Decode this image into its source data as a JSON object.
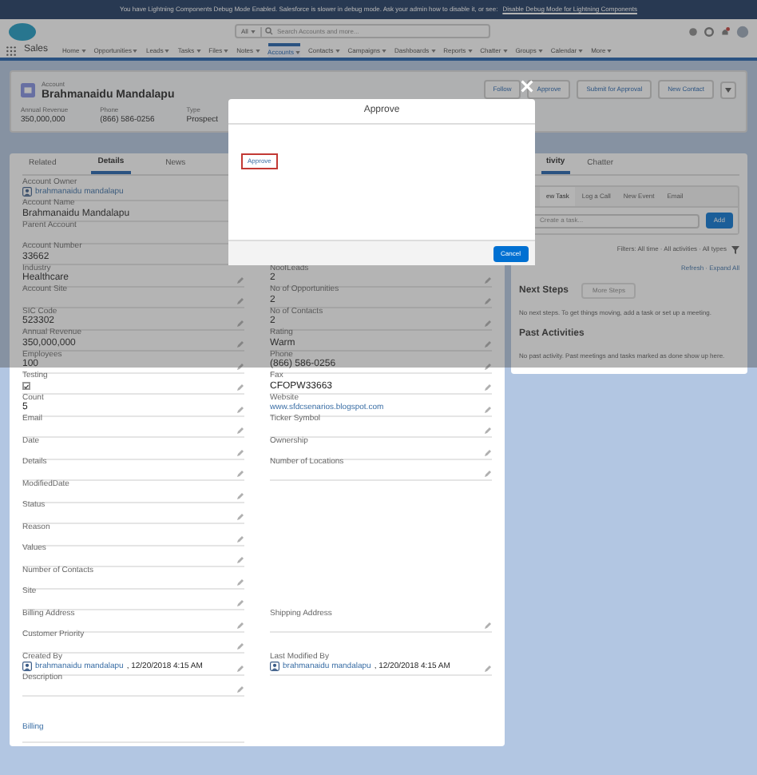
{
  "banner": {
    "text": "You have Lightning Components Debug Mode Enabled. Salesforce is slower in debug mode. Ask your admin how to disable it, or see:",
    "link": "Disable Debug Mode for Lightning Components"
  },
  "header": {
    "search_scope": "All",
    "search_placeholder": "Search Accounts and more..."
  },
  "nav": {
    "app": "Sales",
    "items": [
      {
        "label": "Home",
        "selected": false
      },
      {
        "label": "Opportunities",
        "selected": false
      },
      {
        "label": "Leads",
        "selected": false
      },
      {
        "label": "Tasks",
        "selected": false
      },
      {
        "label": "Files",
        "selected": false
      },
      {
        "label": "Notes",
        "selected": false
      },
      {
        "label": "Accounts",
        "selected": true
      },
      {
        "label": "Contacts",
        "selected": false
      },
      {
        "label": "Campaigns",
        "selected": false
      },
      {
        "label": "Dashboards",
        "selected": false
      },
      {
        "label": "Reports",
        "selected": false
      },
      {
        "label": "Chatter",
        "selected": false
      },
      {
        "label": "Groups",
        "selected": false
      },
      {
        "label": "Calendar",
        "selected": false
      },
      {
        "label": "More",
        "selected": false
      }
    ]
  },
  "record": {
    "type": "Account",
    "name": "Brahmanaidu Mandalapu",
    "actions": [
      "Follow",
      "Approve",
      "Submit for Approval",
      "New Contact"
    ],
    "highlights": [
      {
        "label": "Annual Revenue",
        "value": "350,000,000"
      },
      {
        "label": "Phone",
        "value": "(866) 586-0256"
      },
      {
        "label": "Type",
        "value": "Prospect"
      }
    ]
  },
  "tabs": [
    {
      "label": "Related",
      "selected": false
    },
    {
      "label": "Details",
      "selected": true
    },
    {
      "label": "News",
      "selected": false
    }
  ],
  "rows": [
    {
      "left": {
        "label": "Account Owner",
        "kind": "user",
        "value": "brahmanaidu mandalapu"
      }
    },
    {
      "left": {
        "label": "Account Name",
        "kind": "text",
        "value": "Brahmanaidu Mandalapu"
      }
    },
    {
      "left": {
        "label": "Parent Account",
        "kind": "text"
      }
    },
    {
      "left": {
        "label": "Account Number",
        "kind": "text",
        "value": "33662"
      }
    },
    {
      "left": {
        "label": "Industry",
        "kind": "text",
        "value": "Healthcare"
      },
      "right": {
        "label": "NoofLeads",
        "kind": "text",
        "value": "2"
      }
    },
    {
      "left": {
        "label": "Account Site",
        "kind": "text"
      },
      "right": {
        "label": "No of Opportunities",
        "kind": "text",
        "value": "2"
      }
    },
    {
      "left": {
        "label": "SIC Code",
        "kind": "text",
        "value": "523302"
      },
      "right": {
        "label": "No of Contacts",
        "kind": "text",
        "value": "2"
      }
    },
    {
      "left": {
        "label": "Annual Revenue",
        "kind": "text",
        "value": "350,000,000"
      },
      "right": {
        "label": "Rating",
        "kind": "text",
        "value": "Warm"
      }
    },
    {
      "left": {
        "label": "Employees",
        "kind": "text",
        "value": "100"
      },
      "right": {
        "label": "Phone",
        "kind": "text",
        "value": "(866) 586-0256"
      }
    },
    {
      "left": {
        "label": "Testing",
        "kind": "checkbox",
        "checked": true
      },
      "right": {
        "label": "Fax",
        "kind": "text",
        "value": "CFOPW33663"
      }
    },
    {
      "left": {
        "label": "Count",
        "kind": "text",
        "value": "5"
      },
      "right": {
        "label": "Website",
        "kind": "link",
        "value": "www.sfdcsenarios.blogspot.com"
      }
    },
    {
      "left": {
        "label": "Email",
        "kind": "text"
      },
      "right": {
        "label": "Ticker Symbol",
        "kind": "text"
      }
    },
    {
      "left": {
        "label": "Date",
        "kind": "text"
      },
      "right": {
        "label": "Ownership",
        "kind": "text"
      }
    },
    {
      "left": {
        "label": "Details",
        "kind": "text"
      },
      "right": {
        "label": "Number of Locations",
        "kind": "text"
      }
    },
    {
      "left": {
        "label": "ModifiedDate",
        "kind": "text"
      }
    },
    {
      "left": {
        "label": "Status",
        "kind": "text"
      }
    },
    {
      "left": {
        "label": "Reason",
        "kind": "text"
      }
    },
    {
      "left": {
        "label": "Values",
        "kind": "text"
      }
    },
    {
      "left": {
        "label": "Number of Contacts",
        "kind": "text"
      }
    },
    {
      "left": {
        "label": "Site",
        "kind": "text"
      }
    },
    {
      "left": {
        "label": "Billing Address",
        "kind": "text"
      },
      "right": {
        "label": "Shipping Address",
        "kind": "text"
      }
    },
    {
      "left": {
        "label": "Customer Priority",
        "kind": "text"
      }
    },
    {
      "left": {
        "label": "Created By",
        "kind": "user",
        "value": "brahmanaidu mandalapu",
        "suffix": ", 12/20/2018 4:15 AM"
      },
      "right": {
        "label": "Last Modified By",
        "kind": "user",
        "value": "brahmanaidu mandalapu",
        "suffix": ", 12/20/2018 4:15 AM"
      }
    },
    {
      "left": {
        "label": "Description",
        "kind": "text"
      }
    },
    {
      "left": {
        "label": "Billing",
        "kind": "section"
      }
    }
  ],
  "activity": {
    "tabs": [
      {
        "label": "tivity",
        "selected": true
      },
      {
        "label": "Chatter",
        "selected": false
      }
    ],
    "actions": [
      {
        "label": "ew Task",
        "selected": true
      },
      {
        "label": "Log a Call",
        "selected": false
      },
      {
        "label": "New Event",
        "selected": false
      },
      {
        "label": "Email",
        "selected": false
      }
    ],
    "task_placeholder": "Create a task...",
    "add": "Add",
    "filters": "Filters: All time · All activities · All types",
    "links": "Refresh · Expand All",
    "next_steps": "Next Steps",
    "more_steps": "More Steps",
    "next_empty": "No next steps. To get things moving, add a task or set up a meeting.",
    "past": "Past Activities",
    "past_empty": "No past activity. Past meetings and tasks marked as done show up here."
  },
  "modal": {
    "title": "Approve",
    "link": "Approve",
    "cancel": "Cancel"
  }
}
